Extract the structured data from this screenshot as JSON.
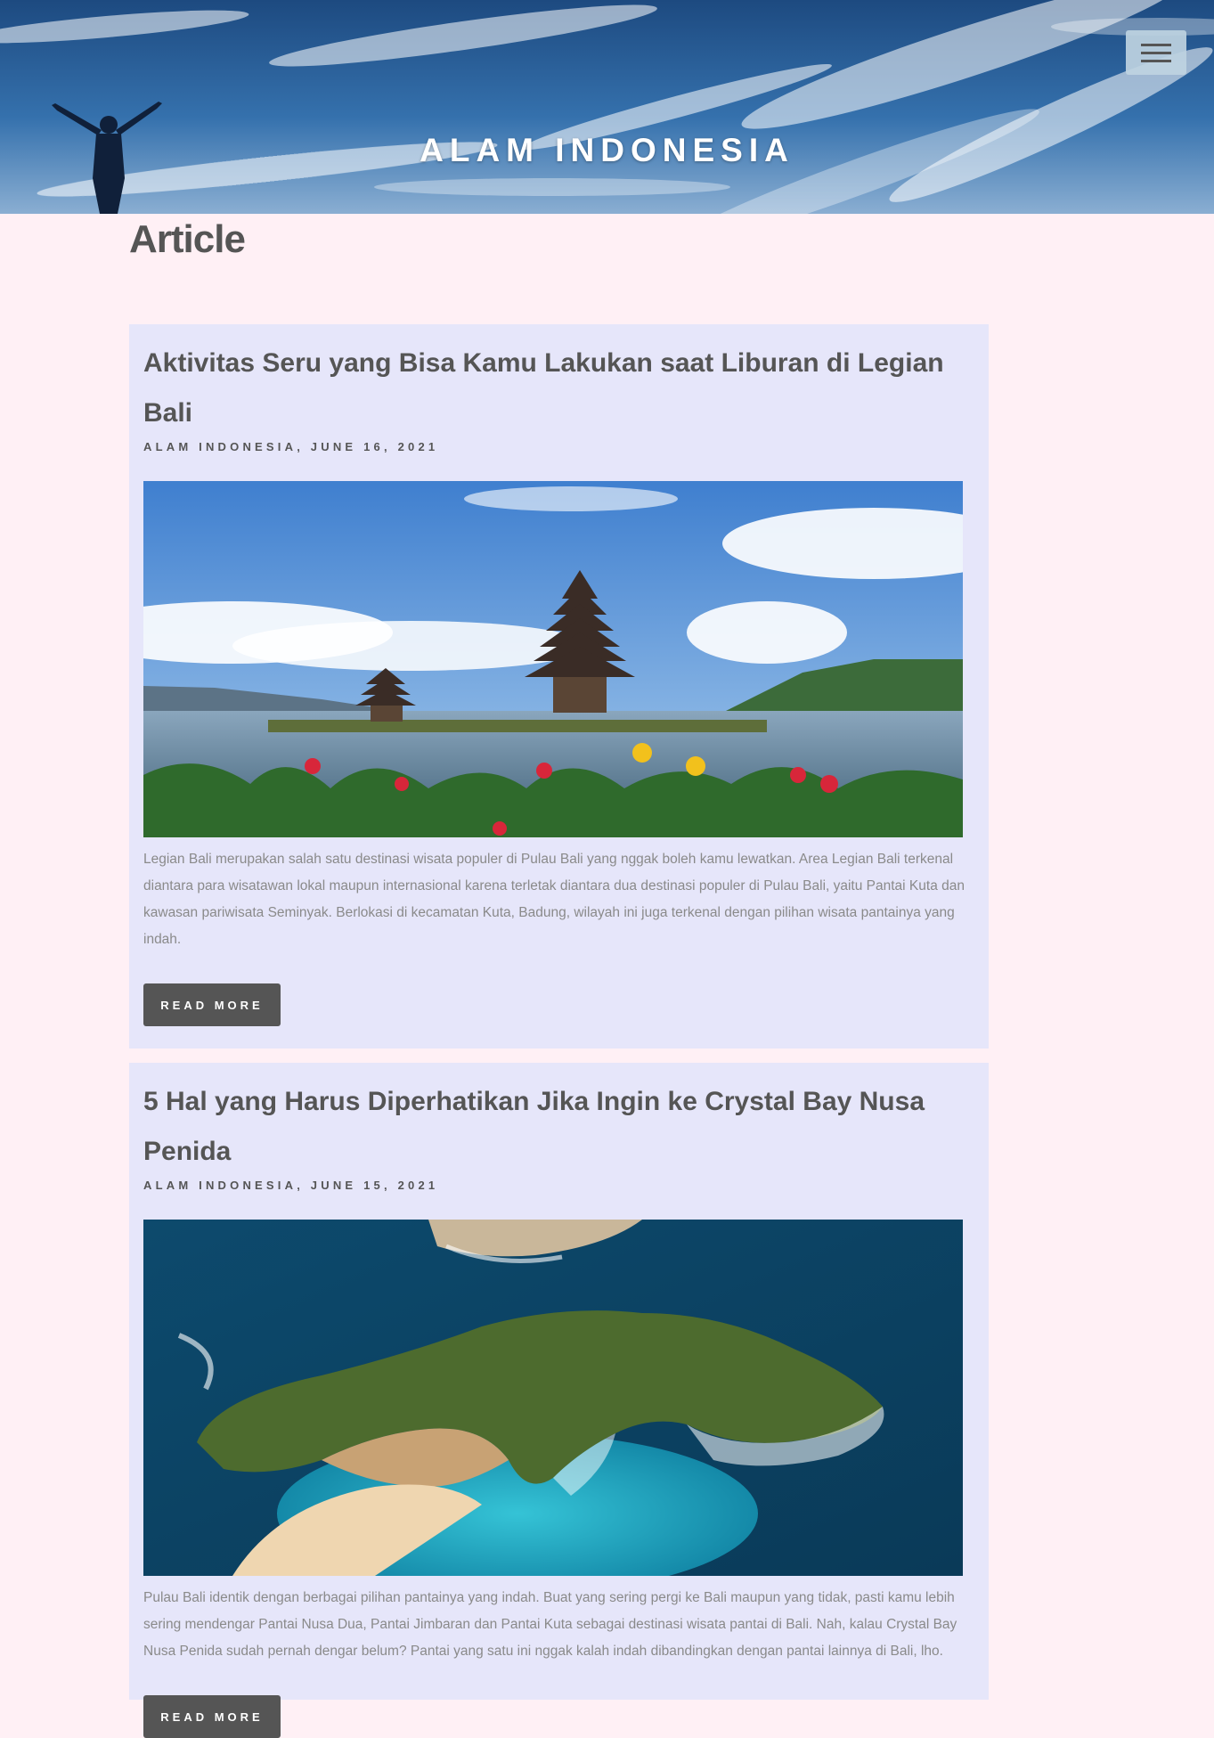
{
  "header": {
    "site_title": "ALAM INDONESIA",
    "menu_icon": "hamburger-menu-icon"
  },
  "main": {
    "heading": "Article",
    "articles": [
      {
        "title": "Aktivitas Seru yang Bisa Kamu Lakukan saat Liburan di Legian Bali",
        "meta": "ALAM INDONESIA, JUNE 16, 2021",
        "excerpt": "Legian Bali merupakan salah satu destinasi wisata populer di Pulau Bali yang nggak boleh kamu lewatkan. Area Legian Bali terkenal diantara para wisatawan lokal maupun internasional karena terletak diantara dua destinasi populer di Pulau Bali, yaitu Pantai Kuta dan kawasan pariwisata Seminyak. Berlokasi di kecamatan Kuta, Badung, wilayah ini juga terkenal dengan pilihan wisata pantainya yang indah.",
        "button_label": "READ MORE"
      },
      {
        "title": "5 Hal yang Harus Diperhatikan Jika Ingin ke Crystal Bay Nusa Penida",
        "meta": "ALAM INDONESIA, JUNE 15, 2021",
        "excerpt": "Pulau Bali identik dengan berbagai pilihan pantainya yang indah. Buat yang sering pergi ke Bali maupun yang tidak, pasti kamu lebih sering mendengar Pantai Nusa Dua, Pantai Jimbaran dan Pantai Kuta sebagai destinasi wisata pantai di Bali. Nah, kalau Crystal Bay Nusa Penida sudah pernah dengar belum? Pantai yang satu ini nggak kalah indah dibandingkan dengan pantai lainnya di Bali, lho.",
        "button_label": "READ MORE"
      }
    ]
  },
  "colors": {
    "page_background": "#fff0f5",
    "card_background": "#e6e6fa",
    "text": "#555555",
    "button": "#555555"
  }
}
